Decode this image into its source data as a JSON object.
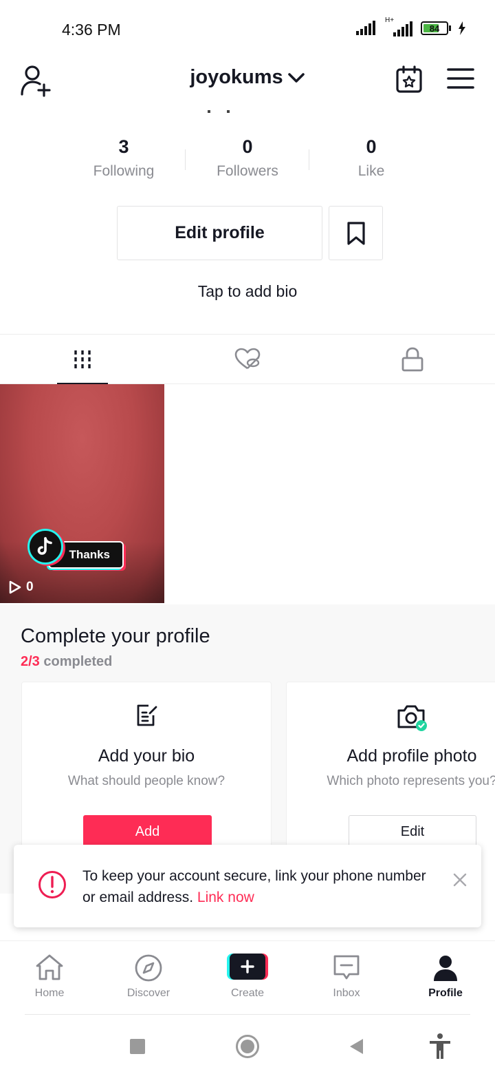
{
  "status_bar": {
    "time": "4:36 PM",
    "network_label": "H+",
    "battery": "84"
  },
  "header": {
    "username": "joyokums"
  },
  "stats": [
    {
      "value": "3",
      "label": "Following"
    },
    {
      "value": "0",
      "label": "Followers"
    },
    {
      "value": "0",
      "label": "Like"
    }
  ],
  "profile": {
    "edit_label": "Edit profile",
    "bio_prompt": "Tap to add bio"
  },
  "video": {
    "sticker_text": "Thanks",
    "play_count": "0"
  },
  "complete_profile": {
    "title": "Complete your profile",
    "progress_done": "2/3",
    "progress_suffix": " completed",
    "cards": [
      {
        "title": "Add your bio",
        "subtitle": "What should people know?",
        "button": "Add"
      },
      {
        "title": "Add profile photo",
        "subtitle": "Which photo represents you?",
        "button": "Edit"
      }
    ]
  },
  "toast": {
    "message": "To keep your account secure, link your phone number or email address. ",
    "link": "Link now"
  },
  "nav": [
    {
      "label": "Home",
      "icon": "home-icon"
    },
    {
      "label": "Discover",
      "icon": "compass-icon"
    },
    {
      "label": "Create",
      "icon": "plus-icon"
    },
    {
      "label": "Inbox",
      "icon": "inbox-icon"
    },
    {
      "label": "Profile",
      "icon": "person-icon"
    }
  ],
  "colors": {
    "accent": "#fe2c55",
    "cyan": "#25f4ee",
    "text": "#161823",
    "muted": "#8a8b91"
  }
}
